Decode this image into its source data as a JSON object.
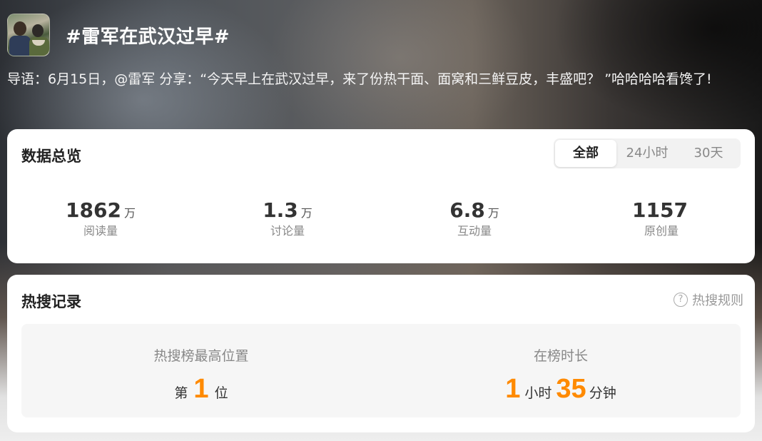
{
  "topic": {
    "title": "#雷军在武汉过早#",
    "intro": "导语：6月15日，@雷军 分享：“今天早上在武汉过早，来了份热干面、面窝和三鲜豆皮，丰盛吧？ ”哈哈哈哈看馋了!"
  },
  "overview": {
    "title": "数据总览",
    "tabs": [
      "全部",
      "24小时",
      "30天"
    ],
    "active_tab": "全部",
    "stats": [
      {
        "value": "1862",
        "unit": "万",
        "label": "阅读量"
      },
      {
        "value": "1.3",
        "unit": "万",
        "label": "讨论量"
      },
      {
        "value": "6.8",
        "unit": "万",
        "label": "互动量"
      },
      {
        "value": "1157",
        "unit": "",
        "label": "原创量"
      }
    ]
  },
  "hot": {
    "title": "热搜记录",
    "rules_label": "热搜规则",
    "peak": {
      "label": "热搜榜最高位置",
      "prefix": "第",
      "value": "1",
      "suffix": "位"
    },
    "duration": {
      "label": "在榜时长",
      "hours": "1",
      "hours_unit": "小时",
      "minutes": "35",
      "minutes_unit": "分钟"
    }
  },
  "colors": {
    "accent": "#ff8a00",
    "card_bg": "#ffffff",
    "muted": "#888888"
  }
}
